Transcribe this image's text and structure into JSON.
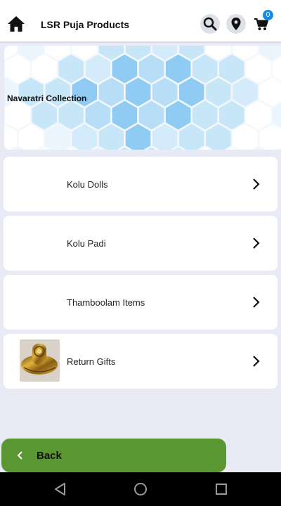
{
  "app_bar": {
    "title": "LSR Puja Products",
    "home_icon": "home-icon",
    "search_icon": "search-icon",
    "location_icon": "location-pin-icon",
    "cart_icon": "cart-icon",
    "cart_count": "0"
  },
  "banner": {
    "title": "Navaratri Collection"
  },
  "categories": [
    {
      "label": "Kolu Dolls"
    },
    {
      "label": "Kolu Padi"
    },
    {
      "label": "Thamboolam Items"
    },
    {
      "label": "Return Gifts"
    }
  ],
  "back_button": {
    "label": "Back"
  },
  "colors": {
    "accent_green": "#5a9732",
    "badge_blue": "#1e88e5",
    "page_background": "#e8ebf5"
  },
  "system_nav": {
    "back_icon": "triangle-back-icon",
    "home_icon": "circle-home-icon",
    "recents_icon": "square-recents-icon"
  }
}
